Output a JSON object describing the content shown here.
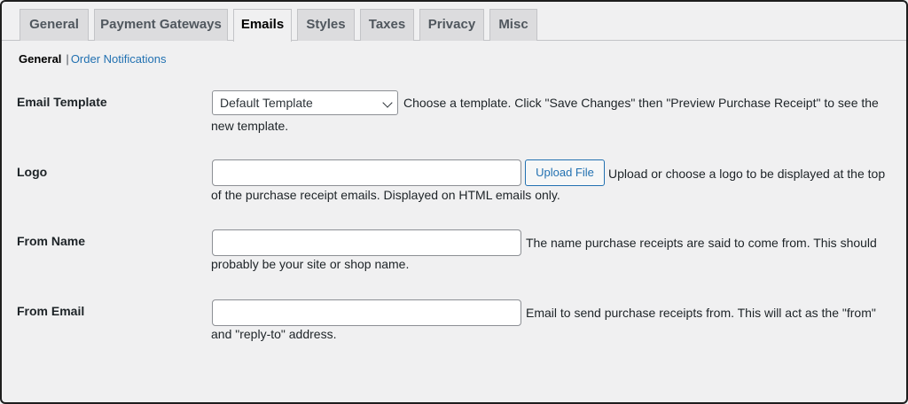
{
  "tabs": [
    {
      "label": "General"
    },
    {
      "label": "Payment Gateways"
    },
    {
      "label": "Emails"
    },
    {
      "label": "Styles"
    },
    {
      "label": "Taxes"
    },
    {
      "label": "Privacy"
    },
    {
      "label": "Misc"
    }
  ],
  "active_tab": "Emails",
  "subnav": {
    "current": "General",
    "separator": "|",
    "link": "Order Notifications"
  },
  "fields": {
    "email_template": {
      "label": "Email Template",
      "selected": "Default Template",
      "desc_line1": "Choose a template. Click \"Save Changes\" then \"Preview Purchase Receipt\" to see the",
      "desc_line2": "new template."
    },
    "logo": {
      "label": "Logo",
      "value": "",
      "button": "Upload File",
      "desc_line1": "Upload or choose a logo to be displayed at the top",
      "desc_line2": "of the purchase receipt emails. Displayed on HTML emails only."
    },
    "from_name": {
      "label": "From Name",
      "value": "",
      "desc_line1": "The name purchase receipts are said to come from. This should",
      "desc_line2": "probably be your site or shop name."
    },
    "from_email": {
      "label": "From Email",
      "value": "",
      "desc_line1": "Email to send purchase receipts from. This will act as the \"from\"",
      "desc_line2": "and \"reply-to\" address."
    }
  },
  "colors": {
    "link": "#2271b1",
    "background": "#f0f0f1",
    "tab_inactive": "#dcdcde"
  }
}
